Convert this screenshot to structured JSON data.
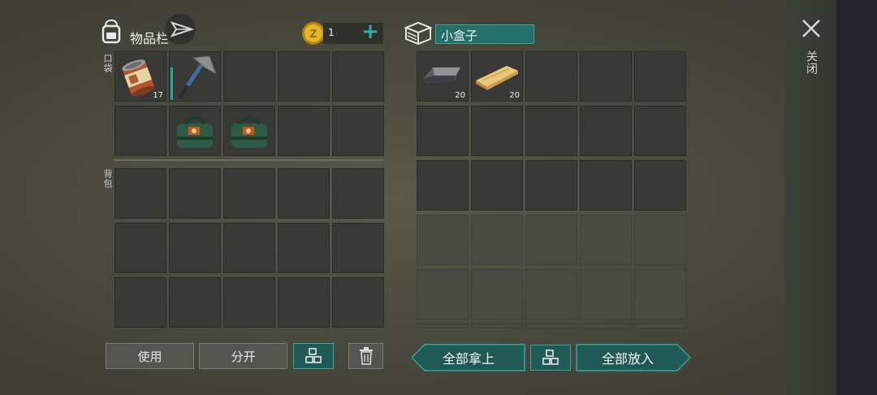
{
  "inventory": {
    "title": "物品栏",
    "pocket_label": "口袋",
    "backpack_label": "背包",
    "coin_count": "1",
    "add_symbol": "+",
    "items": {
      "can": {
        "icon": "tin-can-icon",
        "count": "17"
      },
      "pickaxe": {
        "icon": "pickaxe-icon"
      },
      "bag1": {
        "icon": "green-supply-bag-icon"
      },
      "bag2": {
        "icon": "green-supply-bag-icon"
      }
    }
  },
  "container": {
    "name": "小盒子",
    "items": {
      "iron": {
        "icon": "iron-ingot-icon",
        "count": "20"
      },
      "plank": {
        "icon": "wood-plank-icon",
        "count": "20"
      }
    }
  },
  "close": {
    "label": "关闭"
  },
  "actions": {
    "use": "使用",
    "split": "分开",
    "take_all": "全部拿上",
    "put_all": "全部放入"
  },
  "colors": {
    "teal": "#1f5a57",
    "teal_border": "#3aa39a",
    "cell": "#383835"
  }
}
